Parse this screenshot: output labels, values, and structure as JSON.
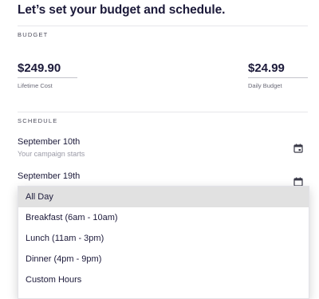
{
  "heading": "Let’s set your budget and schedule.",
  "budget": {
    "section_label": "BUDGET",
    "lifetime_value": "$249.90",
    "lifetime_label": "Lifetime Cost",
    "daily_value": "$24.99",
    "daily_label": "Daily Budget"
  },
  "schedule": {
    "section_label": "SCHEDULE",
    "start_date": "September 10th",
    "start_caption": "Your campaign starts",
    "end_date": "September 19th"
  },
  "dropdown": {
    "options": [
      {
        "label": "All Day",
        "selected": true
      },
      {
        "label": "Breakfast (6am - 10am)",
        "selected": false
      },
      {
        "label": "Lunch (11am - 3pm)",
        "selected": false
      },
      {
        "label": "Dinner (4pm - 9pm)",
        "selected": false
      },
      {
        "label": "Custom Hours",
        "selected": false
      }
    ]
  },
  "icons": {
    "calendar": "calendar-icon"
  },
  "colors": {
    "text_primary": "#1c1a3a",
    "selected_bg": "#e1e1e1"
  }
}
